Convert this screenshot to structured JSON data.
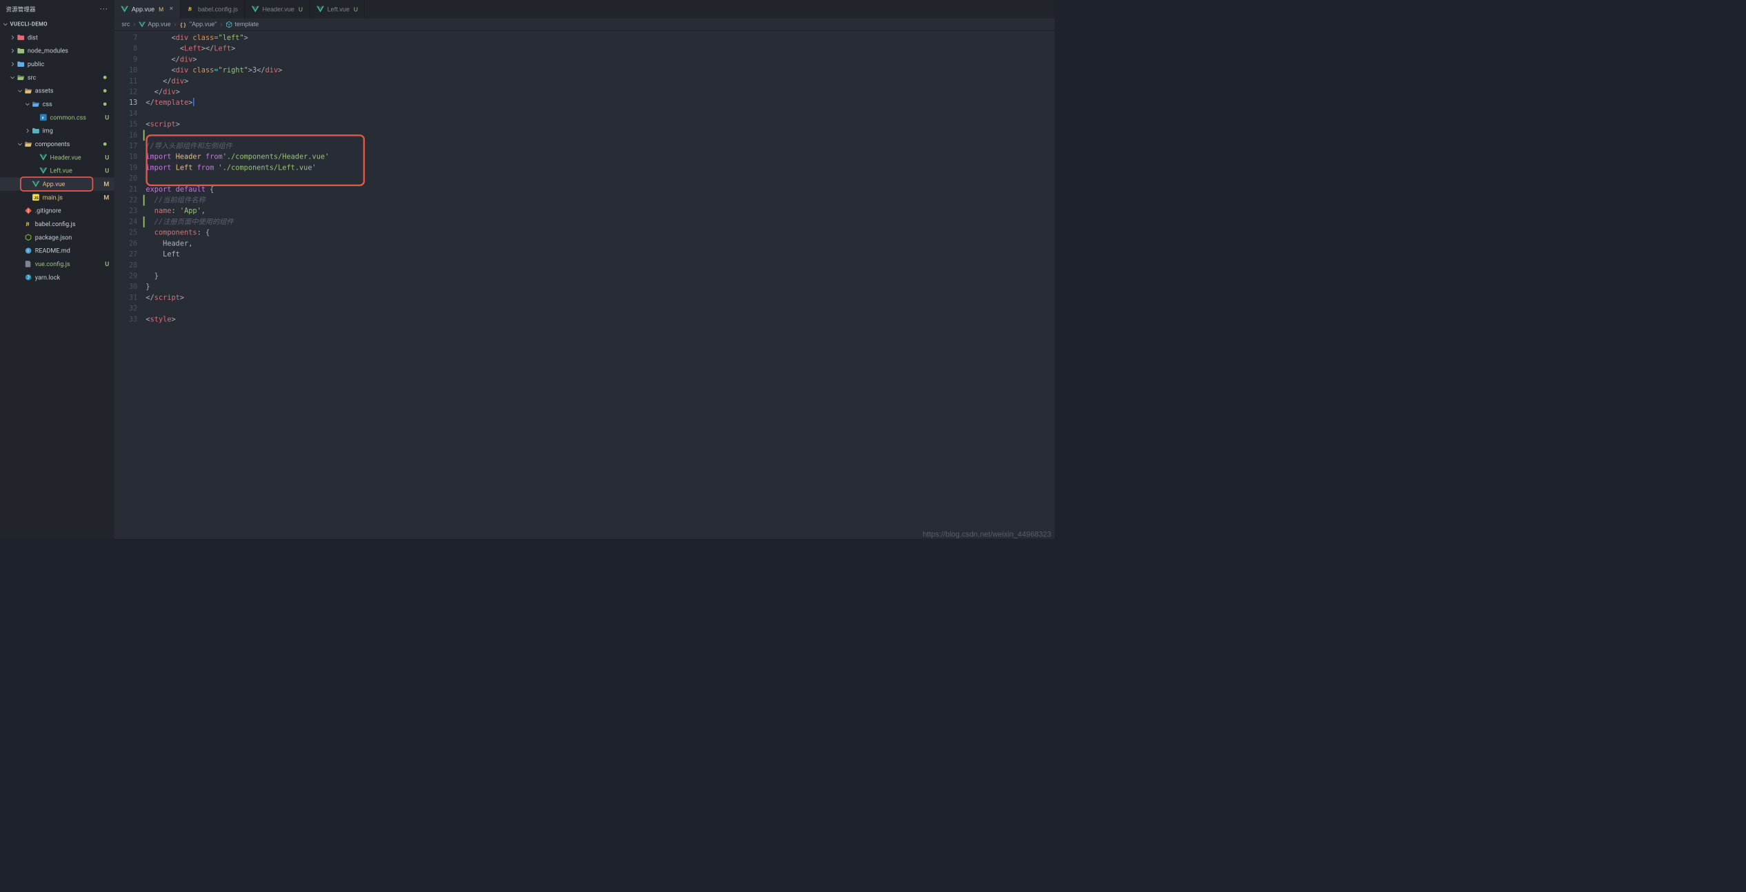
{
  "explorer": {
    "title": "资源管理器",
    "root": "VUECLI-DEMO",
    "more": "···",
    "tree": [
      {
        "id": "dist",
        "label": "dist",
        "type": "folder-red",
        "expanded": false,
        "indent": 22,
        "status": ""
      },
      {
        "id": "node_modules",
        "label": "node_modules",
        "type": "folder-green",
        "expanded": false,
        "indent": 22,
        "status": ""
      },
      {
        "id": "public",
        "label": "public",
        "type": "folder-blue",
        "expanded": false,
        "indent": 22,
        "status": ""
      },
      {
        "id": "src",
        "label": "src",
        "type": "folder-src",
        "expanded": true,
        "indent": 22,
        "status": "dot"
      },
      {
        "id": "assets",
        "label": "assets",
        "type": "folder-assets",
        "expanded": true,
        "indent": 40,
        "status": "dot"
      },
      {
        "id": "css",
        "label": "css",
        "type": "folder-css",
        "expanded": true,
        "indent": 58,
        "status": "dot"
      },
      {
        "id": "common-css",
        "label": "common.css",
        "type": "file-css",
        "file": true,
        "indent": 76,
        "status": "U",
        "untracked": true
      },
      {
        "id": "img",
        "label": "img",
        "type": "folder-img",
        "expanded": false,
        "indent": 58,
        "status": ""
      },
      {
        "id": "components",
        "label": "components",
        "type": "folder-comp",
        "expanded": true,
        "indent": 40,
        "status": "dot"
      },
      {
        "id": "header-vue",
        "label": "Header.vue",
        "type": "file-vue",
        "file": true,
        "indent": 76,
        "status": "U",
        "untracked": true
      },
      {
        "id": "left-vue",
        "label": "Left.vue",
        "type": "file-vue",
        "file": true,
        "indent": 76,
        "status": "U",
        "untracked": true
      },
      {
        "id": "app-vue",
        "label": "App.vue",
        "type": "file-vue",
        "file": true,
        "indent": 58,
        "status": "M",
        "mod": true,
        "active": true,
        "ring": true
      },
      {
        "id": "main-js",
        "label": "main.js",
        "type": "file-js",
        "file": true,
        "indent": 58,
        "status": "M",
        "mod": true
      },
      {
        "id": "gitignore",
        "label": ".gitignore",
        "type": "file-git",
        "file": true,
        "indent": 40,
        "status": ""
      },
      {
        "id": "babel-cfg",
        "label": "babel.config.js",
        "type": "file-babel",
        "file": true,
        "indent": 40,
        "status": ""
      },
      {
        "id": "package-json",
        "label": "package.json",
        "type": "file-node",
        "file": true,
        "indent": 40,
        "status": ""
      },
      {
        "id": "readme",
        "label": "README.md",
        "type": "file-info",
        "file": true,
        "indent": 40,
        "status": ""
      },
      {
        "id": "vue-config",
        "label": "vue.config.js",
        "type": "file-vuecfg",
        "file": true,
        "indent": 40,
        "status": "U",
        "untracked": true
      },
      {
        "id": "yarn-lock",
        "label": "yarn.lock",
        "type": "file-yarn",
        "file": true,
        "indent": 40,
        "status": ""
      }
    ]
  },
  "tabs": [
    {
      "id": "app",
      "icon": "vue",
      "label": "App.vue",
      "suffix": "M",
      "sclass": "m",
      "active": true,
      "closeable": true
    },
    {
      "id": "babel",
      "icon": "babel",
      "label": "babel.config.js",
      "suffix": "",
      "sclass": "",
      "active": false,
      "closeable": false
    },
    {
      "id": "header",
      "icon": "vue",
      "label": "Header.vue",
      "suffix": "U",
      "sclass": "u",
      "active": false,
      "closeable": false
    },
    {
      "id": "left",
      "icon": "vue",
      "label": "Left.vue",
      "suffix": "U",
      "sclass": "u",
      "active": false,
      "closeable": false
    }
  ],
  "crumbs": {
    "c0": "src",
    "c1": "App.vue",
    "c2": "\"App.vue\"",
    "c3": "template"
  },
  "code": {
    "first_line": 7,
    "current_line": 13,
    "glyph_lines": [
      16,
      22,
      24
    ],
    "lines": [
      {
        "n": 7,
        "html": "      <span class='p'>&lt;</span><span class='tag'>div</span> <span class='attr'>class</span><span class='op'>=</span><span class='str'>\"left\"</span><span class='p'>&gt;</span>"
      },
      {
        "n": 8,
        "html": "        <span class='p'>&lt;</span><span class='tag'>Left</span><span class='p'>&gt;&lt;/</span><span class='tag'>Left</span><span class='p'>&gt;</span>"
      },
      {
        "n": 9,
        "html": "      <span class='p'>&lt;/</span><span class='tag'>div</span><span class='p'>&gt;</span>"
      },
      {
        "n": 10,
        "html": "      <span class='p'>&lt;</span><span class='tag'>div</span> <span class='attr'>class</span><span class='op'>=</span><span class='str'>\"right\"</span><span class='p'>&gt;</span><span class='p'>3</span><span class='p'>&lt;/</span><span class='tag'>div</span><span class='p'>&gt;</span>"
      },
      {
        "n": 11,
        "html": "    <span class='p'>&lt;/</span><span class='tag'>div</span><span class='p'>&gt;</span>"
      },
      {
        "n": 12,
        "html": "  <span class='p'>&lt;/</span><span class='tag'>div</span><span class='p'>&gt;</span>"
      },
      {
        "n": 13,
        "html": "<span class='p'>&lt;/</span><span class='tag'>template</span><span class='p'>&gt;</span><span class='cursor'></span>"
      },
      {
        "n": 14,
        "html": ""
      },
      {
        "n": 15,
        "html": "<span class='p'>&lt;</span><span class='tag'>script</span><span class='p'>&gt;</span>"
      },
      {
        "n": 16,
        "html": ""
      },
      {
        "n": 17,
        "html": "<span class='com'>//导入头部组件和左侧组件</span>"
      },
      {
        "n": 18,
        "html": "<span class='kw'>import</span> <span class='cls'>Header</span> <span class='kw'>from</span><span class='str'>'./components/Header.vue'</span>"
      },
      {
        "n": 19,
        "html": "<span class='kw'>import</span> <span class='cls'>Left</span> <span class='kw'>from</span> <span class='str'>'./components/Left.vue'</span>"
      },
      {
        "n": 20,
        "html": ""
      },
      {
        "n": 21,
        "html": "<span class='kw'>export</span> <span class='kw'>default</span> <span class='brkt'>{</span>"
      },
      {
        "n": 22,
        "html": "  <span class='com'>//当前组件名称</span>"
      },
      {
        "n": 23,
        "html": "  <span class='var'>name</span><span class='p'>:</span> <span class='str'>'App'</span><span class='p'>,</span>"
      },
      {
        "n": 24,
        "html": "  <span class='com'>//注册页面中使用的组件</span>"
      },
      {
        "n": 25,
        "html": "  <span class='var'>components</span><span class='p'>:</span> <span class='brkt'>{</span>"
      },
      {
        "n": 26,
        "html": "    <span class='p'>Header,</span>"
      },
      {
        "n": 27,
        "html": "    <span class='p'>Left</span>"
      },
      {
        "n": 28,
        "html": "    "
      },
      {
        "n": 29,
        "html": "  <span class='brkt'>}</span>"
      },
      {
        "n": 30,
        "html": "<span class='brkt'>}</span>"
      },
      {
        "n": 31,
        "html": "<span class='p'>&lt;/</span><span class='tag'>script</span><span class='p'>&gt;</span>"
      },
      {
        "n": 32,
        "html": ""
      },
      {
        "n": 33,
        "html": "<span class='p'>&lt;</span><span class='tag'>style</span><span class='p'>&gt;</span>"
      }
    ]
  },
  "watermark": "https://blog.csdn.net/weixin_44968323"
}
